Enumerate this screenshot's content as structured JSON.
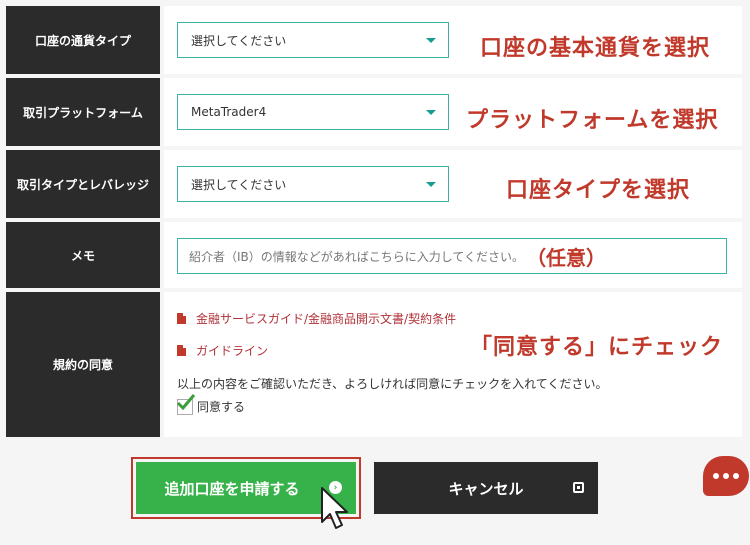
{
  "form": {
    "currency": {
      "label": "口座の通貨タイプ",
      "value": "選択してください",
      "annotation": "口座の基本通貨を選択"
    },
    "platform": {
      "label": "取引プラットフォーム",
      "value": "MetaTrader4",
      "annotation": "プラットフォームを選択"
    },
    "account_type": {
      "label": "取引タイプとレバレッジ",
      "value": "選択してください",
      "annotation": "口座タイプを選択"
    },
    "memo": {
      "label": "メモ",
      "placeholder": "紹介者（IB）の情報などがあればこちらに入力してください。",
      "annotation": "（任意）"
    },
    "terms": {
      "label": "規約の同意",
      "link1": "金融サービスガイド/金融商品開示文書/契約条件",
      "link2": "ガイドライン",
      "annotation": "「同意する」にチェック",
      "notice": "以上の内容をご確認いただき、よろしければ同意にチェックを入れてください。",
      "agree_label": "同意する",
      "agree_checked": true
    }
  },
  "buttons": {
    "submit_label": "追加口座を申請する",
    "submit_icon": "arrow-right-circle-icon",
    "cancel_label": "キャンセル",
    "cancel_icon": "close-square-icon"
  },
  "colors": {
    "label_bg": "#2b2b2b",
    "select_border": "#3ab0a3",
    "annotation": "#c0392b",
    "submit_bg": "#37b14a",
    "submit_highlight": "#c0392b",
    "cancel_bg": "#2b2b2b",
    "chat_bubble": "#c0392b"
  }
}
